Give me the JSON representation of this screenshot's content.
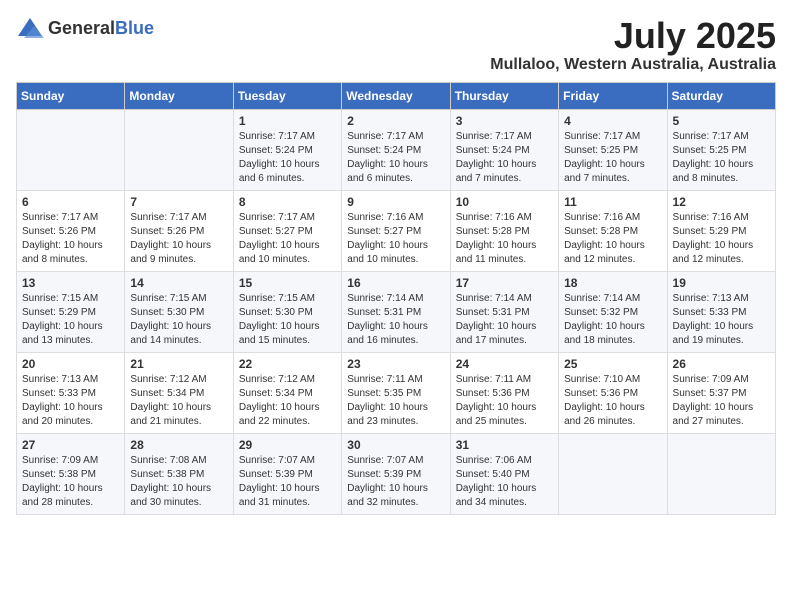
{
  "header": {
    "logo_general": "General",
    "logo_blue": "Blue",
    "month": "July 2025",
    "location": "Mullaloo, Western Australia, Australia"
  },
  "weekdays": [
    "Sunday",
    "Monday",
    "Tuesday",
    "Wednesday",
    "Thursday",
    "Friday",
    "Saturday"
  ],
  "weeks": [
    [
      {
        "day": "",
        "info": ""
      },
      {
        "day": "",
        "info": ""
      },
      {
        "day": "1",
        "info": "Sunrise: 7:17 AM\nSunset: 5:24 PM\nDaylight: 10 hours\nand 6 minutes."
      },
      {
        "day": "2",
        "info": "Sunrise: 7:17 AM\nSunset: 5:24 PM\nDaylight: 10 hours\nand 6 minutes."
      },
      {
        "day": "3",
        "info": "Sunrise: 7:17 AM\nSunset: 5:24 PM\nDaylight: 10 hours\nand 7 minutes."
      },
      {
        "day": "4",
        "info": "Sunrise: 7:17 AM\nSunset: 5:25 PM\nDaylight: 10 hours\nand 7 minutes."
      },
      {
        "day": "5",
        "info": "Sunrise: 7:17 AM\nSunset: 5:25 PM\nDaylight: 10 hours\nand 8 minutes."
      }
    ],
    [
      {
        "day": "6",
        "info": "Sunrise: 7:17 AM\nSunset: 5:26 PM\nDaylight: 10 hours\nand 8 minutes."
      },
      {
        "day": "7",
        "info": "Sunrise: 7:17 AM\nSunset: 5:26 PM\nDaylight: 10 hours\nand 9 minutes."
      },
      {
        "day": "8",
        "info": "Sunrise: 7:17 AM\nSunset: 5:27 PM\nDaylight: 10 hours\nand 10 minutes."
      },
      {
        "day": "9",
        "info": "Sunrise: 7:16 AM\nSunset: 5:27 PM\nDaylight: 10 hours\nand 10 minutes."
      },
      {
        "day": "10",
        "info": "Sunrise: 7:16 AM\nSunset: 5:28 PM\nDaylight: 10 hours\nand 11 minutes."
      },
      {
        "day": "11",
        "info": "Sunrise: 7:16 AM\nSunset: 5:28 PM\nDaylight: 10 hours\nand 12 minutes."
      },
      {
        "day": "12",
        "info": "Sunrise: 7:16 AM\nSunset: 5:29 PM\nDaylight: 10 hours\nand 12 minutes."
      }
    ],
    [
      {
        "day": "13",
        "info": "Sunrise: 7:15 AM\nSunset: 5:29 PM\nDaylight: 10 hours\nand 13 minutes."
      },
      {
        "day": "14",
        "info": "Sunrise: 7:15 AM\nSunset: 5:30 PM\nDaylight: 10 hours\nand 14 minutes."
      },
      {
        "day": "15",
        "info": "Sunrise: 7:15 AM\nSunset: 5:30 PM\nDaylight: 10 hours\nand 15 minutes."
      },
      {
        "day": "16",
        "info": "Sunrise: 7:14 AM\nSunset: 5:31 PM\nDaylight: 10 hours\nand 16 minutes."
      },
      {
        "day": "17",
        "info": "Sunrise: 7:14 AM\nSunset: 5:31 PM\nDaylight: 10 hours\nand 17 minutes."
      },
      {
        "day": "18",
        "info": "Sunrise: 7:14 AM\nSunset: 5:32 PM\nDaylight: 10 hours\nand 18 minutes."
      },
      {
        "day": "19",
        "info": "Sunrise: 7:13 AM\nSunset: 5:33 PM\nDaylight: 10 hours\nand 19 minutes."
      }
    ],
    [
      {
        "day": "20",
        "info": "Sunrise: 7:13 AM\nSunset: 5:33 PM\nDaylight: 10 hours\nand 20 minutes."
      },
      {
        "day": "21",
        "info": "Sunrise: 7:12 AM\nSunset: 5:34 PM\nDaylight: 10 hours\nand 21 minutes."
      },
      {
        "day": "22",
        "info": "Sunrise: 7:12 AM\nSunset: 5:34 PM\nDaylight: 10 hours\nand 22 minutes."
      },
      {
        "day": "23",
        "info": "Sunrise: 7:11 AM\nSunset: 5:35 PM\nDaylight: 10 hours\nand 23 minutes."
      },
      {
        "day": "24",
        "info": "Sunrise: 7:11 AM\nSunset: 5:36 PM\nDaylight: 10 hours\nand 25 minutes."
      },
      {
        "day": "25",
        "info": "Sunrise: 7:10 AM\nSunset: 5:36 PM\nDaylight: 10 hours\nand 26 minutes."
      },
      {
        "day": "26",
        "info": "Sunrise: 7:09 AM\nSunset: 5:37 PM\nDaylight: 10 hours\nand 27 minutes."
      }
    ],
    [
      {
        "day": "27",
        "info": "Sunrise: 7:09 AM\nSunset: 5:38 PM\nDaylight: 10 hours\nand 28 minutes."
      },
      {
        "day": "28",
        "info": "Sunrise: 7:08 AM\nSunset: 5:38 PM\nDaylight: 10 hours\nand 30 minutes."
      },
      {
        "day": "29",
        "info": "Sunrise: 7:07 AM\nSunset: 5:39 PM\nDaylight: 10 hours\nand 31 minutes."
      },
      {
        "day": "30",
        "info": "Sunrise: 7:07 AM\nSunset: 5:39 PM\nDaylight: 10 hours\nand 32 minutes."
      },
      {
        "day": "31",
        "info": "Sunrise: 7:06 AM\nSunset: 5:40 PM\nDaylight: 10 hours\nand 34 minutes."
      },
      {
        "day": "",
        "info": ""
      },
      {
        "day": "",
        "info": ""
      }
    ]
  ]
}
